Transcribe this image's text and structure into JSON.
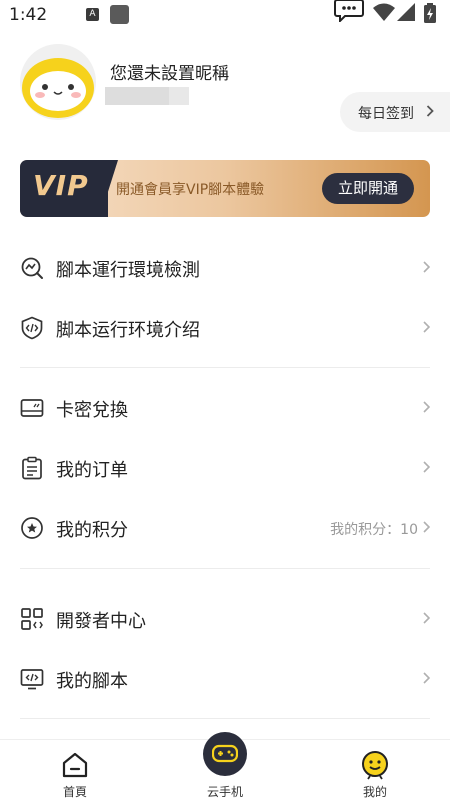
{
  "status_bar": {
    "time": "1:42",
    "notification_letter": "A"
  },
  "profile": {
    "nickname": "您還未設置昵稱",
    "checkin_label": "每日签到"
  },
  "vip": {
    "logo": "VIP",
    "promo_text": "開通會員享VIP腳本體驗",
    "button_label": "立即開通"
  },
  "menu": {
    "env_check": "腳本運行環境檢測",
    "env_intro": "脚本运行环境介绍",
    "card_redeem": "卡密兌換",
    "my_orders": "我的订单",
    "my_points": "我的积分",
    "points_value": "我的积分：10",
    "developer_center": "開發者中心",
    "my_scripts": "我的腳本"
  },
  "tabbar": {
    "home": "首頁",
    "cloud_phone": "云手机",
    "mine": "我的"
  },
  "colors": {
    "accent_yellow": "#f6d21c",
    "vip_dark": "#262a3a",
    "vip_gold": "#d49650"
  }
}
